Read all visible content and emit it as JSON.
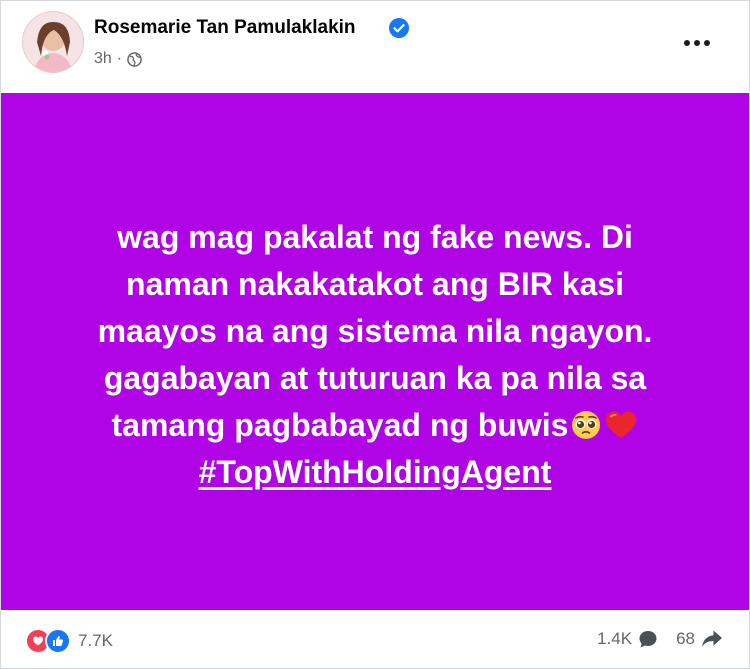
{
  "post": {
    "author": "Rosemarie Tan Pamulaklakin",
    "time": "3h",
    "separator": "·",
    "text_lines": [
      "wag mag pakalat ng fake news. Di",
      "naman nakakatakot ang BIR kasi",
      "maayos na ang sistema nila ngayon.",
      "gagabayan at tuturuan ka pa nila sa",
      "tamang pagbabayad ng buwis"
    ],
    "hashtag": "#TopWithHoldingAgent",
    "background_color": "#b004e6",
    "icons": [
      "avatar",
      "verified-badge-icon",
      "globe-icon",
      "more-options-icon",
      "pleading-face-emoji",
      "red-heart-emoji",
      "love-reaction-icon",
      "like-reaction-icon",
      "comment-icon",
      "share-icon"
    ]
  },
  "stats": {
    "reactions": "7.7K",
    "comments": "1.4K",
    "shares": "68"
  }
}
